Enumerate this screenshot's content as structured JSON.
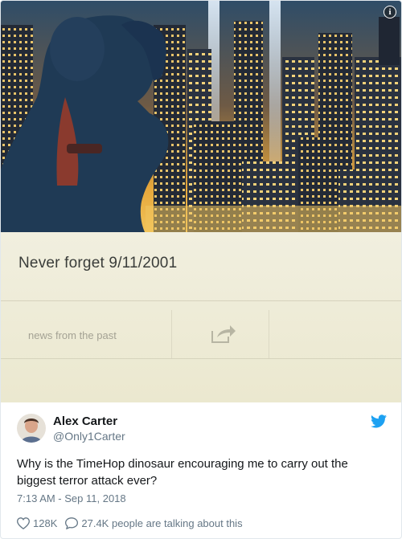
{
  "image": {
    "caption": "Never forget 9/11/2001",
    "source_label": "news from the past",
    "icons": [
      "info-icon",
      "share-icon"
    ]
  },
  "tweet": {
    "author_name": "Alex Carter",
    "author_handle": "@Only1Carter",
    "text": "Why is the TimeHop dinosaur encouraging me to carry out the biggest terror attack ever?",
    "timestamp": "7:13 AM - Sep 11, 2018",
    "likes": "128K",
    "talking": "27.4K people are talking about this"
  },
  "colors": {
    "twitter_blue": "#1da1f2",
    "muted_text": "#657786",
    "sky_top": "#2f4d68",
    "sky_glow": "#e6a63a"
  }
}
